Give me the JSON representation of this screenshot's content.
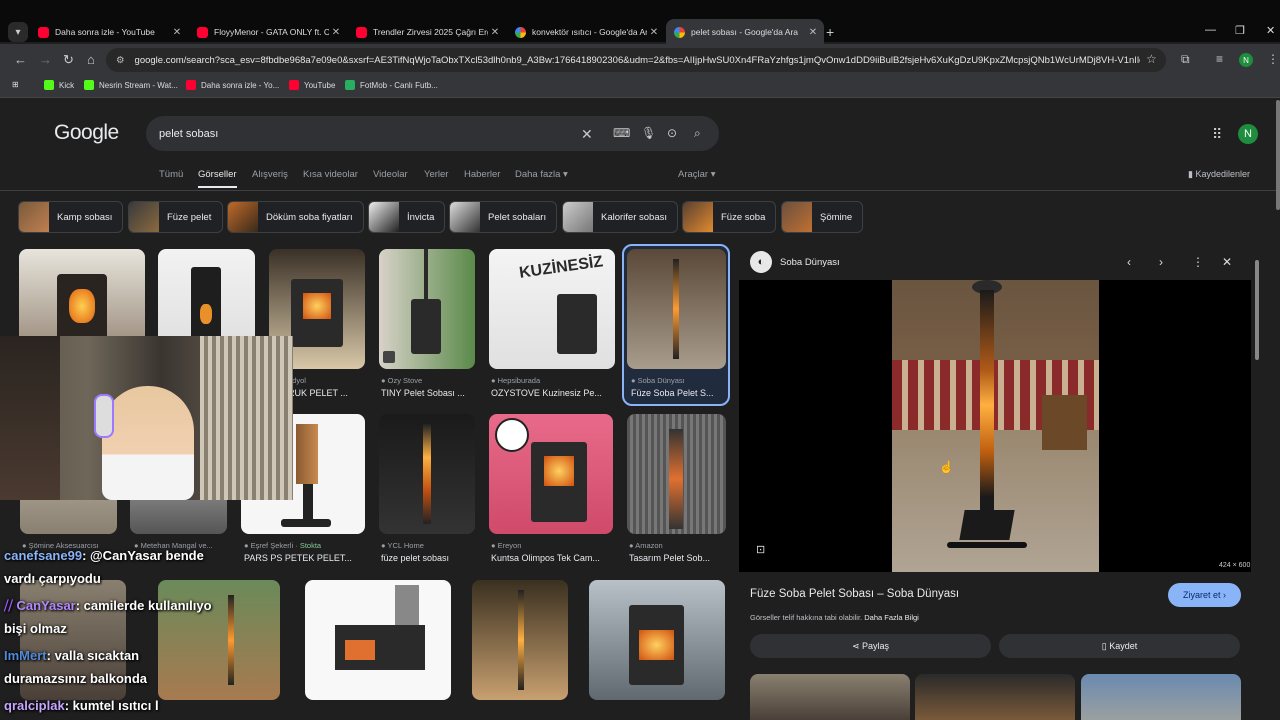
{
  "browser": {
    "tabs": [
      {
        "title": "Daha sonra izle - YouTube",
        "icon": "youtube-icon"
      },
      {
        "title": "FloyyMenor - GATA ONLY ft. Cr",
        "icon": "youtube-icon"
      },
      {
        "title": "Trendler Zirvesi 2025 Çağrı Erg",
        "icon": "youtube-icon"
      },
      {
        "title": "konvektör ısıtıcı - Google'da Ar",
        "icon": "google-icon"
      },
      {
        "title": "pelet sobası - Google'da Ara",
        "icon": "google-icon"
      }
    ],
    "url": "google.com/search?sca_esv=8fbdbe968a7e09e0&sxsrf=AE3TifNqWjoTaObxTXcl53dlh0nb9_A3Bw:1766418902306&udm=2&fbs=AIIjpHwSU0Xn4FRaYzhfgs1jmQvOnw1dDD9iiBulB2fsjeHv6XuKgDzU9KpxZMcpsjQNb1WcUrMDj8VH-V1nIlcqw593...",
    "profile_initial": "N",
    "bookmarks": [
      "Kick",
      "Nesrin Stream - Wat...",
      "Daha sonra izle - Yo...",
      "YouTube",
      "FotMob - Canlı Futb..."
    ]
  },
  "google": {
    "logo": "Google",
    "query": "pelet sobası",
    "avatar_initial": "N",
    "filters": [
      "Tümü",
      "Görseller",
      "Alışveriş",
      "Kısa videolar",
      "Videolar",
      "Yerler",
      "Haberler",
      "Daha fazla"
    ],
    "tools": "Araçlar",
    "saved": "Kaydedilenler",
    "chips": [
      "Kamp sobası",
      "Füze pelet",
      "Döküm soba fiyatları",
      "İnvicta",
      "Pelet sobaları",
      "Kalorifer sobası",
      "Füze soba",
      "Şömine"
    ]
  },
  "results": {
    "row1": [
      {
        "source": "Ozy Stove",
        "title": "TINY Pelet Sobası ..."
      },
      {
        "source": "Hepsiburada",
        "title": "OZYSTOVE Kuzinesiz Pe..."
      },
      {
        "source": "Soba Dünyası",
        "title": "Füze Soba Pelet S..."
      }
    ],
    "row1_partial": {
      "source": "ndyol",
      "title": "RUK PELET ..."
    },
    "kuzinesiz": "KUZİNESİZ",
    "row2": [
      {
        "source": "Şömine Aksesuarcısı",
        "title": ""
      },
      {
        "source": "Metehan Mangal ve...",
        "title": ""
      },
      {
        "source": "Eşref Şekerli",
        "badge": "Stokta",
        "title": "PARS PS PETEK PELET..."
      },
      {
        "source": "YCL Home",
        "title": "füze pelet sobası"
      },
      {
        "source": "Ereyon",
        "title": "Kuntsa Olimpos Tek Cam..."
      },
      {
        "source": "Amazon",
        "title": "Tasarım Pelet Sob..."
      }
    ]
  },
  "panel": {
    "site": "Soba Dünyası",
    "dims": "424 × 600",
    "title": "Füze Soba Pelet Sobası – Soba Dünyası",
    "note": "Görseller telif hakkına tabi olabilir.",
    "note_link": "Daha Fazla Bilgi",
    "visit": "Ziyaret et",
    "share": "Paylaş",
    "save": "Kaydet"
  },
  "chat": [
    {
      "user": "canefsane99",
      "text": ": @CanYasar bende"
    },
    {
      "user": "",
      "text": "vardı çarpıyodu"
    },
    {
      "user": "CanYasar",
      "text": ": camilerde kullanılıyo"
    },
    {
      "user": "",
      "text": "bişi olmaz"
    },
    {
      "user": "ImMert",
      "text": ": valla sıcaktan"
    },
    {
      "user": "",
      "text": "duramazsınız balkonda"
    },
    {
      "user": "qralciplak",
      "text": ": kumtel ısıtıcı l"
    }
  ]
}
